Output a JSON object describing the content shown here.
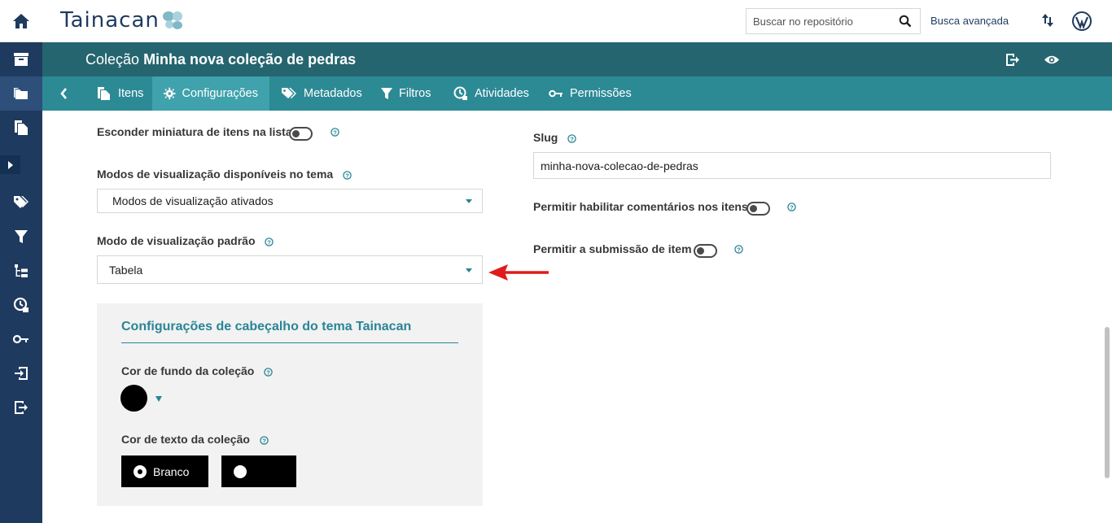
{
  "topbar": {
    "logo_text": "Tainacan",
    "search_placeholder": "Buscar no repositório",
    "advanced_search": "Busca avançada"
  },
  "collection": {
    "prefix": "Coleção",
    "name": "Minha nova coleção de pedras"
  },
  "tabs": [
    {
      "label": "Itens",
      "icon": "items-icon"
    },
    {
      "label": "Configurações",
      "icon": "gear-icon",
      "active": true
    },
    {
      "label": "Metadados",
      "icon": "tags-icon"
    },
    {
      "label": "Filtros",
      "icon": "filter-icon"
    },
    {
      "label": "Atividades",
      "icon": "activities-icon"
    },
    {
      "label": "Permissões",
      "icon": "key-icon"
    }
  ],
  "form": {
    "hide_thumbnails_label": "Esconder miniatura de itens na lista",
    "view_modes_label": "Modos de visualização disponíveis no tema",
    "view_modes_value": "Modos de visualização ativados",
    "default_view_label": "Modo de visualização padrão",
    "default_view_value": "Tabela",
    "slug_label": "Slug",
    "slug_value": "minha-nova-colecao-de-pedras",
    "allow_comments_label": "Permitir habilitar comentários nos itens",
    "allow_submission_label": "Permitir a submissão de item"
  },
  "theme_settings": {
    "title": "Configurações de cabeçalho do tema Tainacan",
    "bg_color_label": "Cor de fundo da coleção",
    "bg_color": "#000000",
    "text_color_label": "Cor de texto da coleção",
    "option_white": "Branco",
    "option_black": ""
  },
  "colors": {
    "sidebar": "#1f3a5f",
    "collection_header": "#25656f",
    "tabs_bar": "#2c8a95",
    "active_tab": "#3fa2ac",
    "accent": "#298596",
    "annotation_arrow": "#e01b1b"
  }
}
